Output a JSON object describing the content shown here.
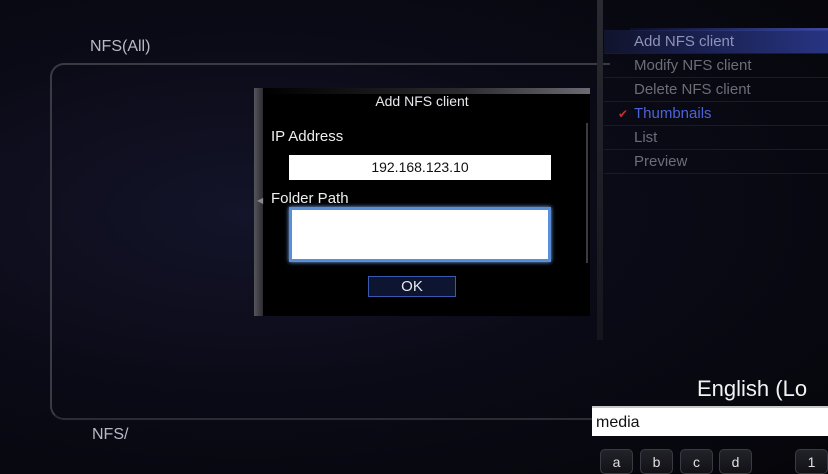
{
  "browser": {
    "title": "NFS(All)",
    "footer_path": "NFS/"
  },
  "menu": {
    "items": [
      {
        "label": "Add NFS client",
        "state": "selected"
      },
      {
        "label": "Modify NFS client",
        "state": "normal"
      },
      {
        "label": "Delete NFS client",
        "state": "normal"
      },
      {
        "label": "Thumbnails",
        "state": "marked"
      },
      {
        "label": "List",
        "state": "normal"
      },
      {
        "label": "Preview",
        "state": "normal"
      }
    ]
  },
  "dialog": {
    "title": "Add NFS client",
    "ip_label": "IP Address",
    "ip_value": "192.168.123.10",
    "folder_label": "Folder Path",
    "folder_value": "",
    "ok_label": "OK"
  },
  "keyboard": {
    "language": "English (Lo",
    "input_value": "media",
    "keys": [
      "a",
      "b",
      "c",
      "d",
      "1"
    ]
  },
  "colors": {
    "focus_border": "#5a8fd8",
    "marked_item": "#4d62d8",
    "marker": "#c62d2d"
  }
}
